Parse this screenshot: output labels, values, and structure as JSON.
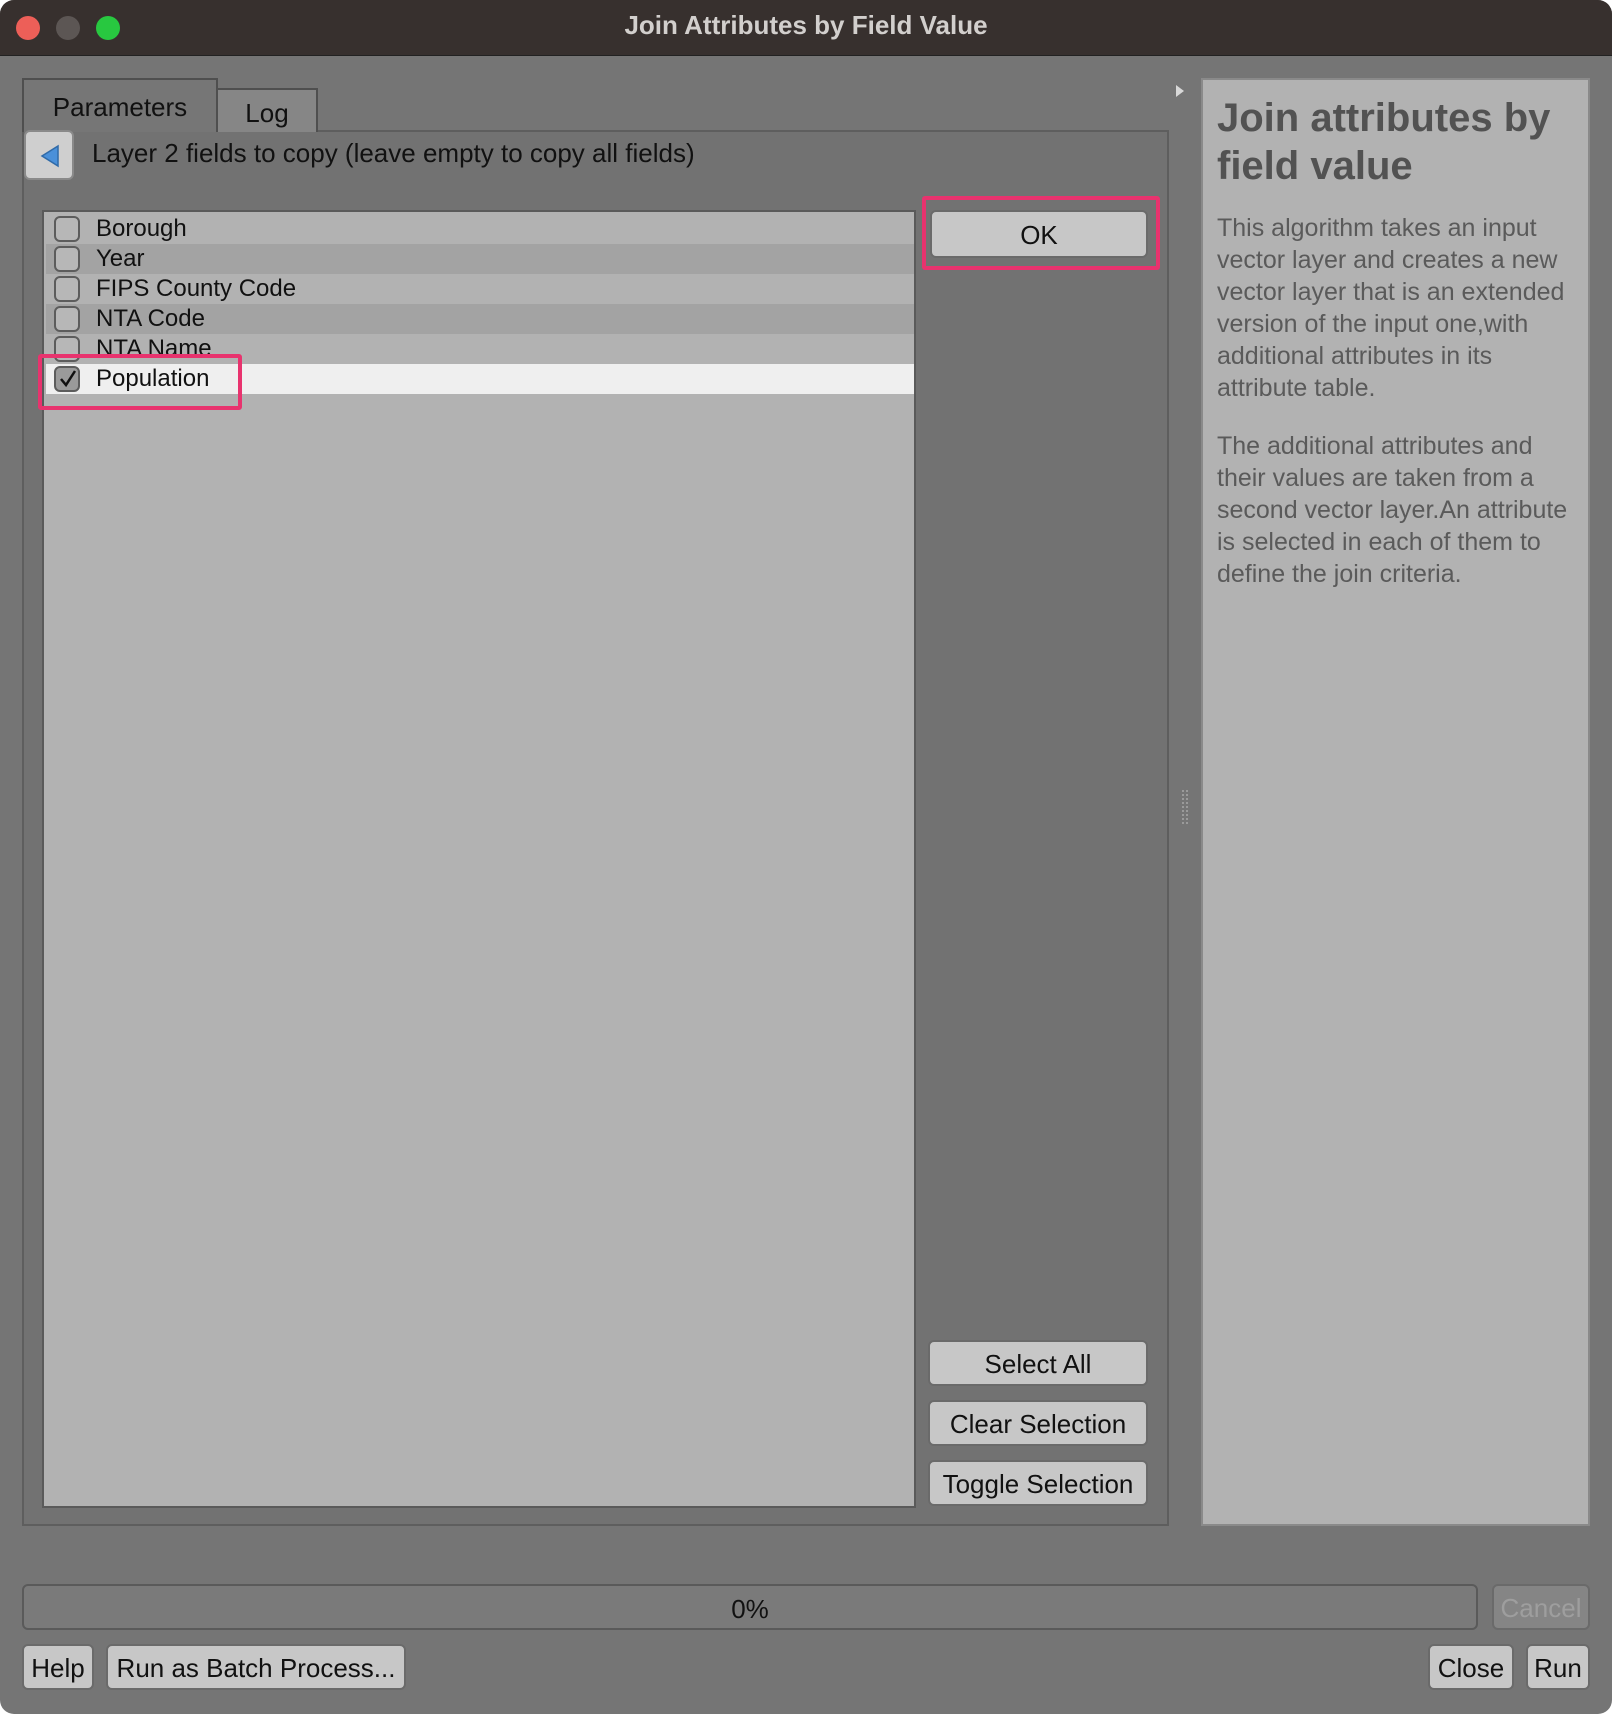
{
  "window": {
    "title": "Join Attributes by Field Value"
  },
  "tabs": [
    {
      "label": "Parameters"
    },
    {
      "label": "Log"
    }
  ],
  "panel": {
    "heading": "Layer 2 fields to copy (leave empty to copy all fields)"
  },
  "fields": [
    {
      "label": "Borough",
      "checked": false
    },
    {
      "label": "Year",
      "checked": false
    },
    {
      "label": "FIPS County Code",
      "checked": false
    },
    {
      "label": "NTA Code",
      "checked": false
    },
    {
      "label": "NTA Name",
      "checked": false
    },
    {
      "label": "Population",
      "checked": true
    }
  ],
  "buttons": {
    "ok": "OK",
    "select_all": "Select All",
    "clear_selection": "Clear Selection",
    "toggle_selection": "Toggle Selection",
    "cancel": "Cancel",
    "help": "Help",
    "batch": "Run as Batch Process...",
    "close": "Close",
    "run": "Run"
  },
  "help": {
    "title": "Join attributes by field value",
    "paragraph1": "This algorithm takes an input vector layer and creates a new vector layer that is an extended version of the input one,with additional attributes in its attribute table.",
    "paragraph2": "The additional attributes and their values are taken from a second vector layer.An attribute is selected in each of them to define the join criteria."
  },
  "progress": {
    "text": "0%",
    "value": 0
  },
  "colors": {
    "highlight": "#e8336e",
    "titlebar": "#37302e"
  }
}
